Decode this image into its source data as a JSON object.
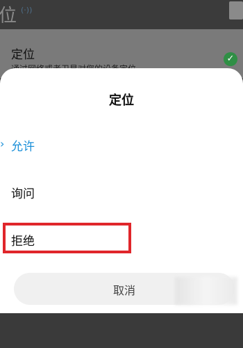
{
  "background": {
    "title_fragment": "位",
    "status_icon": "speaker-icon",
    "row": {
      "title": "定位",
      "description": "通过网络或者卫星对您的设备定位",
      "check_icon": "check-circle-icon"
    }
  },
  "dialog": {
    "title": "定位",
    "options": [
      {
        "label": "允许",
        "selected": true
      },
      {
        "label": "询问",
        "selected": false
      },
      {
        "label": "拒绝",
        "selected": false,
        "highlighted": true
      }
    ],
    "cancel_label": "取消"
  },
  "colors": {
    "accent": "#1a8fd8",
    "highlight": "#e0262b",
    "check": "#2f8f45"
  }
}
